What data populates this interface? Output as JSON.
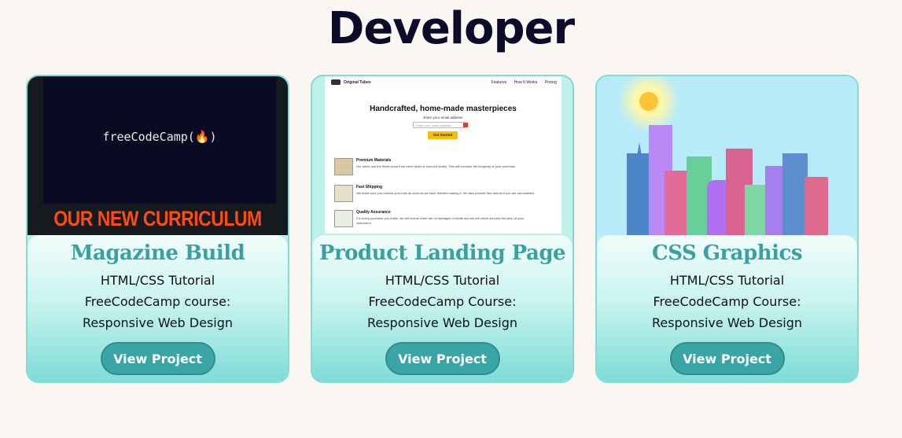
{
  "page": {
    "title": "Developer"
  },
  "cards": [
    {
      "title": "Magazine Build",
      "desc_line1": "HTML/CSS Tutorial",
      "desc_line2": "FreeCodeCamp course:",
      "desc_line3": "Responsive Web Design",
      "button": "View Project",
      "thumb": {
        "logo_text": "freeCodeCamp(🔥)",
        "banner_text": "OUR NEW CURRICULUM"
      }
    },
    {
      "title": "Product Landing Page",
      "desc_line1": "HTML/CSS Tutorial",
      "desc_line2": "FreeCodeCamp Course:",
      "desc_line3": "Responsive Web Design",
      "button": "View Project",
      "thumb": {
        "brand": "Original Tubes",
        "nav": [
          "Features",
          "How It Works",
          "Pricing"
        ],
        "hero": "Handcrafted, home-made masterpieces",
        "sub": "Enter your email address",
        "email_placeholder": "Enter your email address",
        "cta": "Get Started",
        "features": [
          {
            "title": "Premium Materials",
            "text": "Our tubes use the finest wood from trees which is sourced locally. This will increase the longevity of your purchase."
          },
          {
            "title": "Fast Shipping",
            "text": "We make sure you receive your tube as soon as we have finished making it. We also provide free returns if you are not satisfied."
          },
          {
            "title": "Quality Assurance",
            "text": "For every purchase you make, we will ensure there are no damages or faults and we will check and test the pitch of your instrument."
          }
        ]
      }
    },
    {
      "title": "CSS Graphics",
      "desc_line1": "HTML/CSS Tutorial",
      "desc_line2": "FreeCodeCamp Course:",
      "desc_line3": "Responsive Web Design",
      "button": "View Project",
      "thumb": {
        "scene": "city-skyline-with-sun"
      }
    }
  ],
  "colors": {
    "background": "#faf6f1",
    "title": "#0c0b2a",
    "card_title": "#3aa0a0",
    "button": "#3ba4a4",
    "card_border": "#7fdcd6"
  }
}
